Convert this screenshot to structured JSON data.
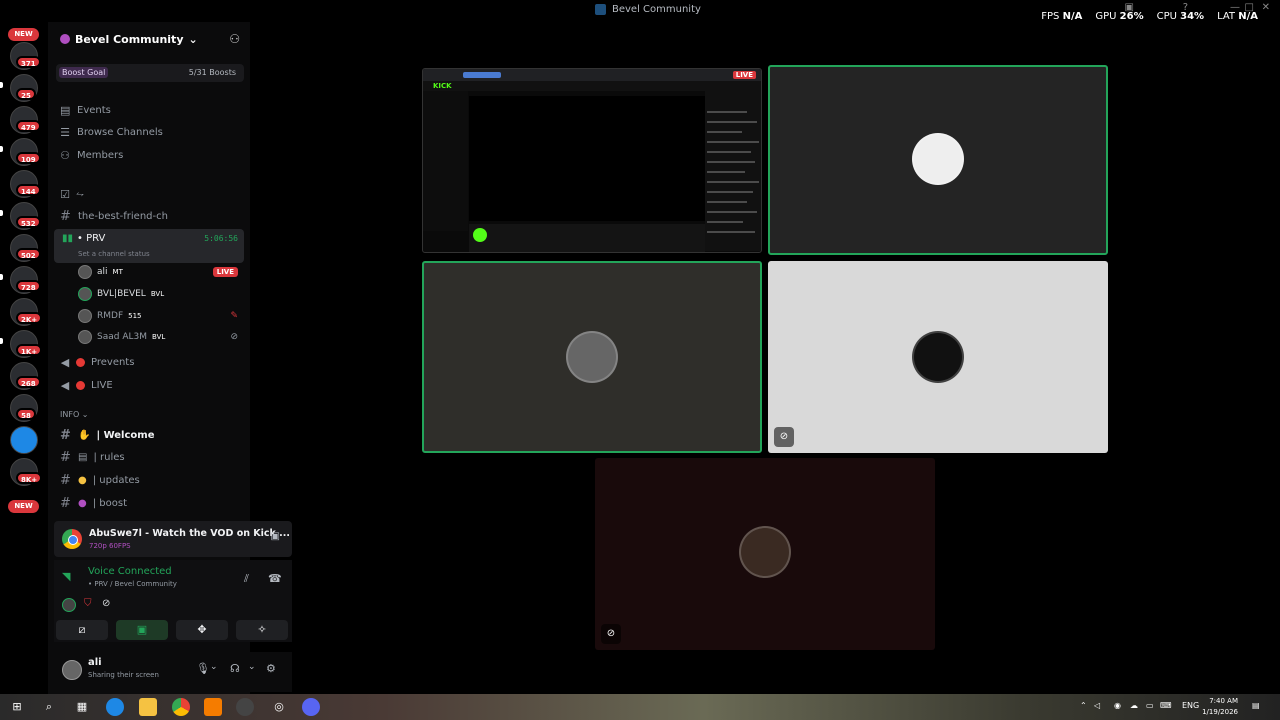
{
  "app": {
    "title": "Bevel Community"
  },
  "perf": {
    "fps_label": "FPS",
    "fps_value": "N/A",
    "gpu_label": "GPU",
    "gpu_value": "26%",
    "cpu_label": "CPU",
    "cpu_value": "34%",
    "lat_label": "LAT",
    "lat_value": "N/A"
  },
  "rail": {
    "new_top": "NEW",
    "badges": [
      "371",
      "25",
      "479",
      "109",
      "144",
      "532",
      "502",
      "728",
      "2K+",
      "1K+",
      "268",
      "58",
      "8K+"
    ],
    "new_bottom": "NEW"
  },
  "server": {
    "name": "Bevel Community"
  },
  "boost": {
    "label": "Boost Goal",
    "count": "5/31 Boosts"
  },
  "nav": {
    "events": "Events",
    "browse": "Browse Channels",
    "members": "Members"
  },
  "channels": {
    "unnamed": "⥊",
    "best_friend": "the-best-friend-ch",
    "prv": {
      "name": "• PRV",
      "time": "5:06:56",
      "status": "Set a channel status"
    },
    "members": [
      {
        "name": "ali",
        "tag": "MT",
        "live": "LIVE"
      },
      {
        "name": "BVL|BEVEL",
        "tag": "BVL"
      },
      {
        "name": "RMDF",
        "tag": "515"
      },
      {
        "name": "Saad AL3M",
        "tag": "BVL"
      }
    ],
    "prevents": "Prevents",
    "live": "LIVE",
    "info_category": "INFO",
    "welcome": "| Welcome",
    "rules": "| rules",
    "updates": "| updates",
    "boost": "| boost"
  },
  "stream": {
    "title": "AbuSwe7l - Watch the VOD on Kick ...",
    "quality": "720p 60FPS"
  },
  "voice": {
    "title": "Voice Connected",
    "sub": "• PRV / Bevel Community"
  },
  "user": {
    "name": "ali",
    "status": "Sharing their screen"
  },
  "screen_share": {
    "live": "LIVE",
    "brand": "KICK"
  },
  "taskbar": {
    "lang": "ENG",
    "time": "7:40 AM",
    "date": "1/19/2026"
  },
  "colors": {
    "accent_green": "#23a55a",
    "live_red": "#da373c",
    "boost_purple": "#b04fc1"
  }
}
